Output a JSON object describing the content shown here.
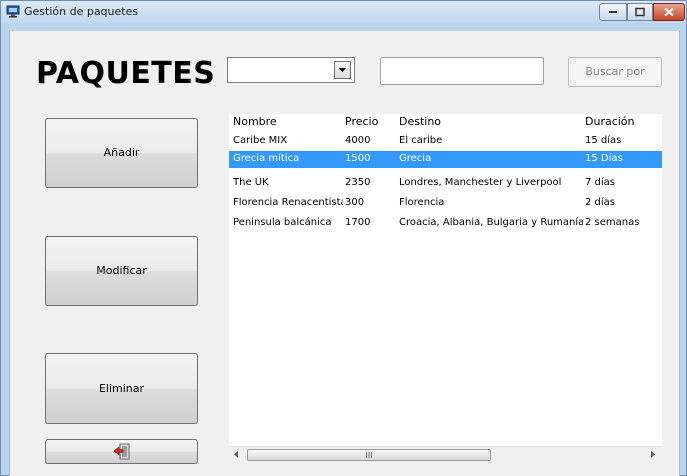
{
  "window": {
    "title": "Gestión de paquetes"
  },
  "main": {
    "heading": "PAQUETES",
    "filter_combo_value": "",
    "search_value": "",
    "search_button_label": "Buscar por"
  },
  "sidebar": {
    "add_label": "Añadir",
    "edit_label": "Modificar",
    "delete_label": "Eliminar"
  },
  "table": {
    "columns": [
      "Nombre",
      "Precio",
      "Destino",
      "Duración"
    ],
    "rows": [
      [
        "Caribe MIX",
        "4000",
        "El caribe",
        "15 días"
      ],
      [
        "Grecia mítica",
        "1500",
        "Grecia",
        "15 Días"
      ],
      [
        "The UK",
        "2350",
        "Londres, Manchester y Liverpool",
        "7 días"
      ],
      [
        "Florencia Renacentista",
        "300",
        "Florencia",
        "2 días"
      ],
      [
        "Peninsula balcánica",
        "1700",
        "Croacia, Albania, Bulgaria y Rumanía",
        "2 semanas"
      ]
    ],
    "selected_row": 1,
    "scroll_grip": "III"
  },
  "icons": {
    "app": "monitor-icon",
    "exit": "exit-door-icon"
  },
  "colors": {
    "selection": "#3399ff",
    "close_button": "#c7452b"
  }
}
